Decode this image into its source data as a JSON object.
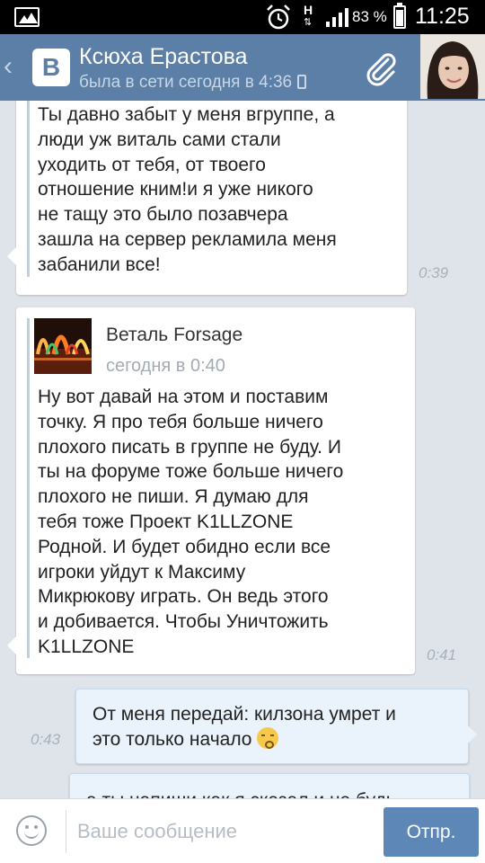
{
  "status_bar": {
    "network_type": "H",
    "network_arrows": "⇅",
    "battery_percent": "83 %",
    "battery_level": 0.83,
    "time": "11:25",
    "icons": [
      "gallery-icon",
      "alarm-icon",
      "signal-icon",
      "battery-icon"
    ]
  },
  "header": {
    "back_glyph": "‹",
    "logo_text": "B",
    "contact_name": "Ксюха Ерастова",
    "contact_status": "была в сети сегодня в 4:36",
    "icons": [
      "chevron-left-icon",
      "vk-logo-icon",
      "phone-icon",
      "paperclip-icon",
      "avatar"
    ]
  },
  "messages": [
    {
      "direction": "incoming",
      "text": "Ты давно забыт у меня вгруппе, а\nлюди уж виталь сами стали\nуходить от тебя, от твоего\nотношение кним!и я уже никого\nне тащу это было позавчера\nзашла на сервер рекламила меня\nзабанили все!",
      "time": "0:39"
    },
    {
      "direction": "incoming",
      "forwarded_author": "Веталь Forsage",
      "forwarded_date": "сегодня в 0:40",
      "text": "Ну вот давай на этом и поставим\nточку. Я про тебя больше ничего\nплохого писать в группе не буду. И\nты на форуме тоже больше ничего\nплохого не пиши. Я думаю для\nтебя тоже Проект K1LLZONE\nРодной. И будет обидно если все\nигроки уйдут к Максиму\nМикрюкову играть. Он ведь этого\nи добивается. Чтобы Уничтожить\nK1LLZONE",
      "time": "0:41"
    },
    {
      "direction": "outgoing",
      "text": "От меня передай: килзона умрет и\nэто только начало",
      "emoji": "kissing-face-emoji",
      "time": "0:43"
    },
    {
      "direction": "outgoing",
      "text": "а ты напиши как я сказал и не будь",
      "time": ""
    }
  ],
  "composer": {
    "placeholder": "Ваше сообщение",
    "value": "",
    "send_label": "Отпр.",
    "icons": [
      "smiley-icon"
    ]
  },
  "colors": {
    "header_bg": "#5b7fa6",
    "chat_bg": "#dfe4ea",
    "outgoing_bubble": "#eaf3fb",
    "send_button": "#5c87b6"
  }
}
